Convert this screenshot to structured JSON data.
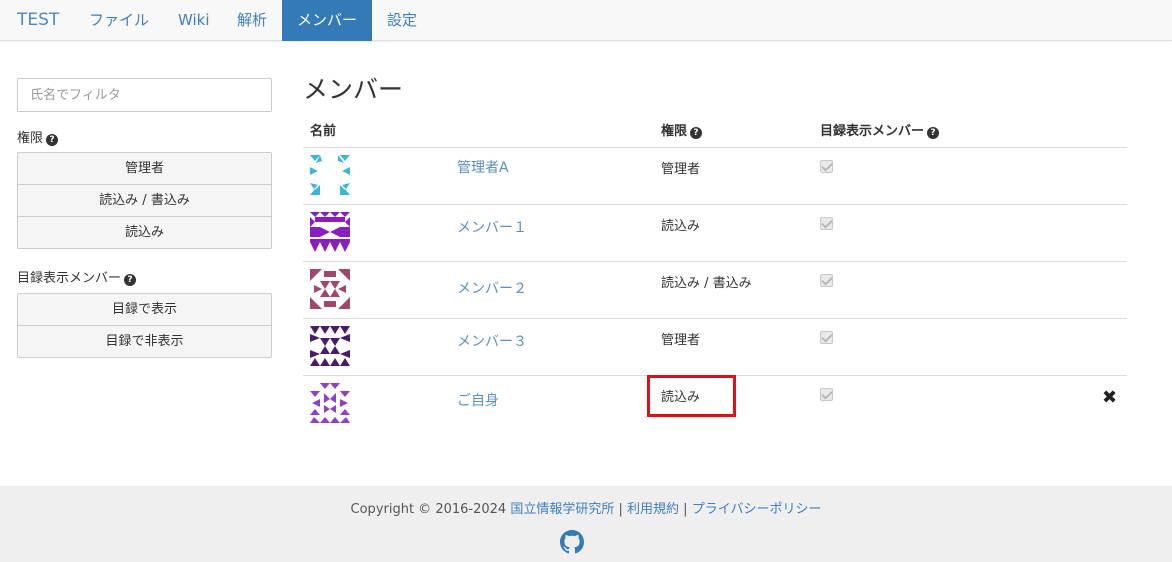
{
  "navbar": {
    "brand": "TEST",
    "items": [
      {
        "label": "ファイル"
      },
      {
        "label": "Wiki"
      },
      {
        "label": "解析"
      },
      {
        "label": "メンバー",
        "active": true
      },
      {
        "label": "設定"
      }
    ]
  },
  "sidebar": {
    "filter_placeholder": "氏名でフィルタ",
    "permission_label": "権限",
    "permission_buttons": [
      "管理者",
      "読込み / 書込み",
      "読込み"
    ],
    "directory_label": "目録表示メンバー",
    "directory_buttons": [
      "目録で表示",
      "目録で非表示"
    ]
  },
  "main": {
    "title": "メンバー",
    "columns": {
      "name": "名前",
      "permission": "権限",
      "directory": "目録表示メンバー"
    },
    "members": [
      {
        "name": "管理者A",
        "permission": "管理者",
        "directory_checked": true,
        "avatar_color": "#3bb6d9"
      },
      {
        "name": "メンバー１",
        "permission": "読込み",
        "directory_checked": true,
        "avatar_color": "#8a1fbf"
      },
      {
        "name": "メンバー２",
        "permission": "読込み / 書込み",
        "directory_checked": true,
        "avatar_color": "#a0476f"
      },
      {
        "name": "メンバー３",
        "permission": "管理者",
        "directory_checked": true,
        "avatar_color": "#4a1a6b"
      },
      {
        "name": "ご自身",
        "permission": "読込み",
        "directory_checked": true,
        "avatar_color": "#8f40c9",
        "removable": true
      }
    ],
    "remove_icon": "✖"
  },
  "footer": {
    "copyright": "Copyright © 2016-2024",
    "links": [
      "国立情報学研究所",
      "利用規約",
      "プライバシーポリシー"
    ],
    "separator": "|",
    "icon": "github-icon"
  },
  "colors": {
    "accent": "#337ab7",
    "link": "#3f7fbf",
    "highlight": "#e0101a"
  }
}
